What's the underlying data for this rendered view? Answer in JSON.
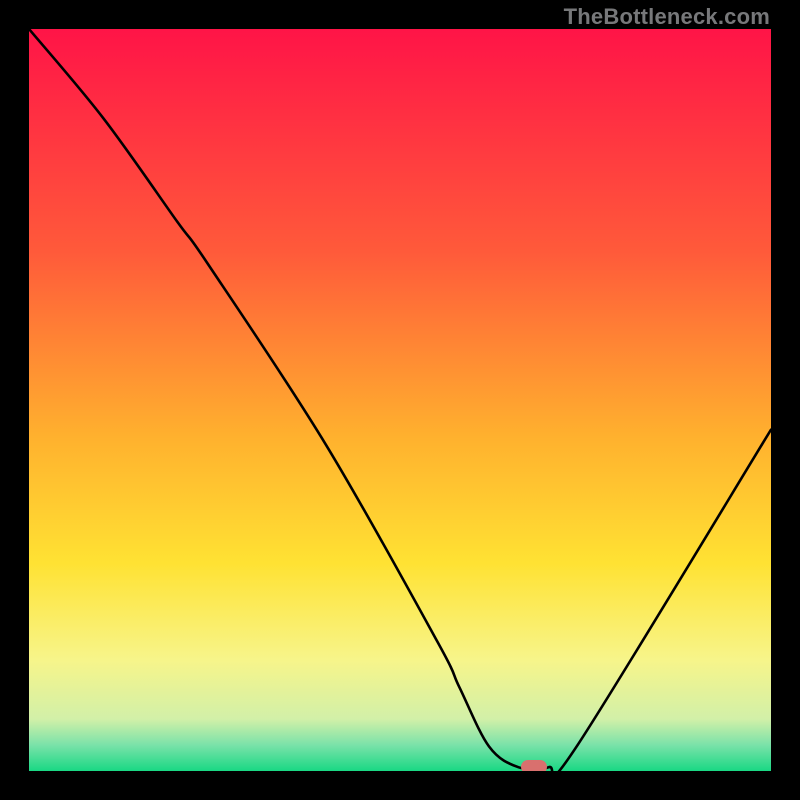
{
  "watermark": "TheBottleneck.com",
  "chart_data": {
    "type": "line",
    "title": "",
    "xlabel": "",
    "ylabel": "",
    "xlim": [
      0,
      100
    ],
    "ylim": [
      0,
      100
    ],
    "series": [
      {
        "name": "bottleneck-curve",
        "x": [
          0,
          10,
          20,
          24,
          40,
          55,
          58,
          62,
          66,
          70,
          74,
          100
        ],
        "values": [
          100,
          88,
          74,
          68.5,
          44,
          17.5,
          11.3,
          3.3,
          0.5,
          0.5,
          3.6,
          46
        ]
      }
    ],
    "marker": {
      "x": 68,
      "y": 0.5
    },
    "background_gradient": [
      {
        "stop": 0.0,
        "color": "#ff1447"
      },
      {
        "stop": 0.3,
        "color": "#ff5a3a"
      },
      {
        "stop": 0.55,
        "color": "#ffb12e"
      },
      {
        "stop": 0.72,
        "color": "#ffe233"
      },
      {
        "stop": 0.85,
        "color": "#f7f58a"
      },
      {
        "stop": 0.93,
        "color": "#d2f0a8"
      },
      {
        "stop": 0.965,
        "color": "#7ae2a9"
      },
      {
        "stop": 1.0,
        "color": "#19d884"
      }
    ]
  }
}
